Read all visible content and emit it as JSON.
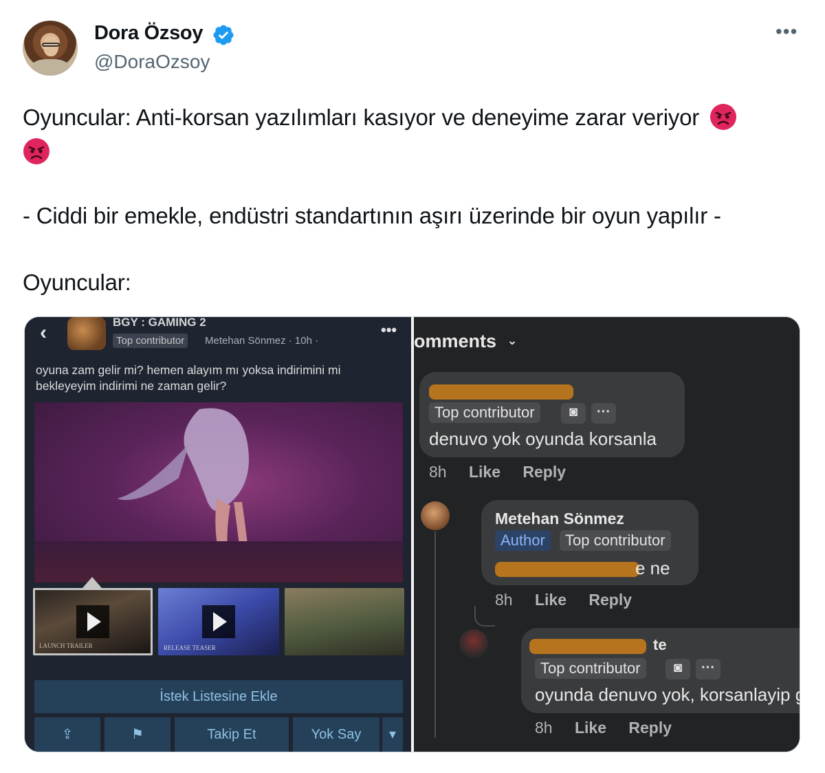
{
  "author": {
    "name": "Dora Özsoy",
    "handle": "@DoraOzsoy",
    "verified": true,
    "verified_color": "#1d9bf0"
  },
  "more_icon": "more-horizontal-icon",
  "tweet": {
    "line1": "Oyuncular: Anti-korsan yazılımları kasıyor ve deneyime zarar veriyor",
    "line2": "- Ciddi bir emekle, endüstri standartının aşırı üzerinde bir oyun yapılır -",
    "line3": "Oyuncular:",
    "emoji": "angry-face-emoji"
  },
  "steam_post": {
    "group_name": "BGY : GAMING 2",
    "badge": "Top contributor",
    "meta": "Metehan Sönmez · 10h ·",
    "text": "oyuna zam gelir mi? hemen alayım mı yoksa indirimini mi bekleyeyim indirimi ne zaman gelir?",
    "thumb1_caption": "LAUNCH TRAILER",
    "thumb2_caption": "RELEASE TEASER",
    "wishlist_button": "İstek Listesine Ekle",
    "follow_button": "Takip Et",
    "ignore_button": "Yok Say"
  },
  "comments": {
    "header": "omments",
    "c1": {
      "badge": "Top contributor",
      "text": "denuvo yok oyunda korsanla",
      "time": "8h",
      "like": "Like",
      "reply": "Reply"
    },
    "c2": {
      "name": "Metehan Sönmez",
      "author_badge": "Author",
      "badge": "Top contributor",
      "text_tail": "e ne",
      "time": "8h",
      "like": "Like",
      "reply": "Reply"
    },
    "c3": {
      "name_tail": "te",
      "badge": "Top contributor",
      "text": "oyunda denuvo yok, korsanlayip ge",
      "time": "8h",
      "like": "Like",
      "reply": "Reply"
    }
  }
}
